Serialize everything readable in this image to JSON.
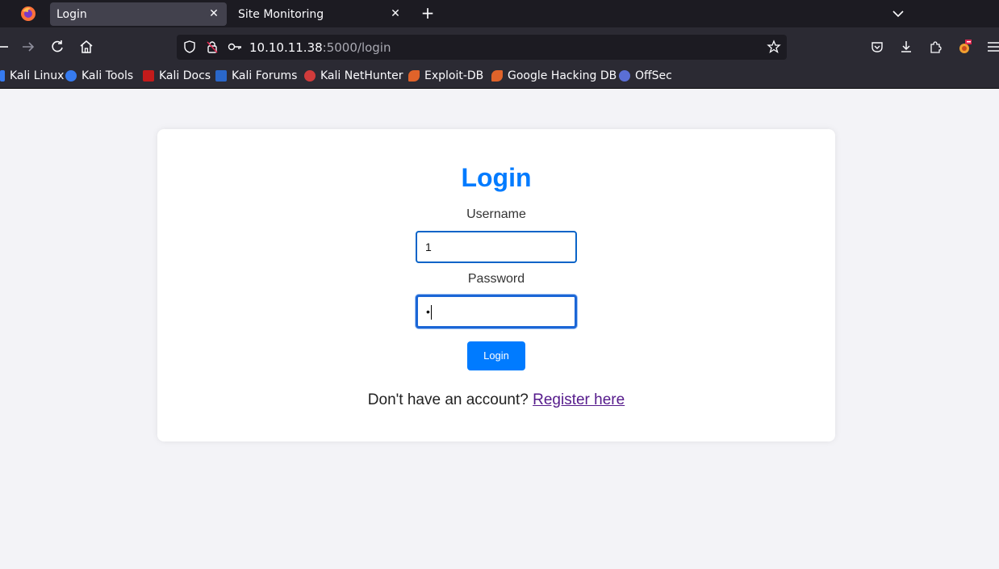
{
  "browser": {
    "tabs": [
      {
        "label": "Login",
        "active": true
      },
      {
        "label": "Site Monitoring",
        "active": false
      }
    ],
    "new_tab_symbol": "+",
    "url_host": "10.10.11.38",
    "url_path": ":5000/login",
    "bookmarks": [
      {
        "label": "Kali Linux",
        "icon": "kali-icon"
      },
      {
        "label": "Kali Tools",
        "icon": "kali-tools-icon"
      },
      {
        "label": "Kali Docs",
        "icon": "kali-docs-icon"
      },
      {
        "label": "Kali Forums",
        "icon": "kali-forums-icon"
      },
      {
        "label": "Kali NetHunter",
        "icon": "nethunter-icon"
      },
      {
        "label": "Exploit-DB",
        "icon": "exploitdb-icon"
      },
      {
        "label": "Google Hacking DB",
        "icon": "ghdb-icon"
      },
      {
        "label": "OffSec",
        "icon": "offsec-icon"
      }
    ]
  },
  "login": {
    "title": "Login",
    "username_label": "Username",
    "username_value": "1",
    "password_label": "Password",
    "password_mask": "•",
    "button_label": "Login",
    "register_prompt": "Don't have an account?",
    "register_link": "Register here"
  },
  "colors": {
    "accent": "#007bff",
    "link_visited": "#551a8b",
    "page_bg": "#f3f3f7"
  }
}
